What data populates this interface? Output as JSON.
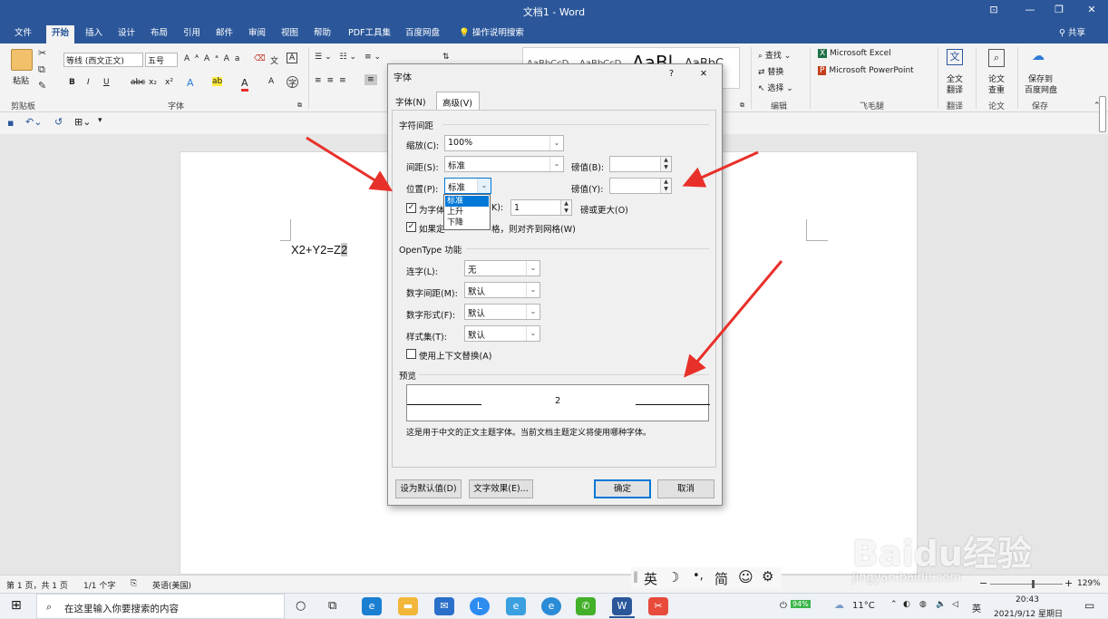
{
  "window": {
    "title": "文档1  -  Word",
    "min": "—",
    "restore": "❐",
    "close": "✕",
    "ribbon_opts": "⊡"
  },
  "tabs": [
    "文件",
    "开始",
    "插入",
    "设计",
    "布局",
    "引用",
    "邮件",
    "审阅",
    "视图",
    "帮助",
    "PDF工具集",
    "百度网盘",
    "操作说明搜索"
  ],
  "share": "共享",
  "ribbon": {
    "paste": "粘贴",
    "clipboard": "剪贴板",
    "font_name": "等线 (西文正文)",
    "font_size": "五号",
    "font_group": "字体",
    "find": "查找",
    "replace": "替换",
    "select": "选择",
    "edit_group": "编辑",
    "excel": "Microsoft Excel",
    "ppt": "Microsoft PowerPoint",
    "feimao": "飞毛腿",
    "fulltext_l1": "全文",
    "fulltext_l2": "翻译",
    "translate_group": "翻译",
    "paper_l1": "论文",
    "paper_l2": "查重",
    "paper_group": "论文",
    "save_l1": "保存到",
    "save_l2": "百度网盘",
    "save_group": "保存",
    "styles": [
      "AaBbCcD",
      "AaBbCcD",
      "AaBl",
      "AaBbC"
    ]
  },
  "document": {
    "text": "X2+Y2=Z",
    "selected": "2"
  },
  "dialog": {
    "title": "字体",
    "help": "?",
    "close": "✕",
    "tab_font": "字体(N)",
    "tab_advanced": "高级(V)",
    "section_spacing": "字符间距",
    "scale_label": "缩放(C):",
    "scale_value": "100%",
    "spacing_label": "间距(S):",
    "spacing_value": "标准",
    "position_label": "位置(P):",
    "position_value": "标准",
    "by1_label": "磅值(B):",
    "by2_label": "磅值(Y):",
    "dropdown": [
      "标准",
      "上升",
      "下降"
    ],
    "kerning_label": "为字体",
    "kerning_k": "K):",
    "kerning_value": "1",
    "kerning_suffix": "磅或更大(O)",
    "grid_label_a": "如果定",
    "grid_label_b": "格，则对齐到网格(W)",
    "section_opentype": "OpenType 功能",
    "ligature_label": "连字(L):",
    "ligature_value": "无",
    "numspacing_label": "数字间距(M):",
    "numspacing_value": "默认",
    "numform_label": "数字形式(F):",
    "numform_value": "默认",
    "styleset_label": "样式集(T):",
    "styleset_value": "默认",
    "contextual_label": "使用上下文替换(A)",
    "section_preview": "预览",
    "preview_text": "2",
    "preview_note": "这是用于中文的正文主题字体。当前文档主题定义将使用哪种字体。",
    "btn_default": "设为默认值(D)",
    "btn_effects": "文字效果(E)...",
    "btn_ok": "确定",
    "btn_cancel": "取消"
  },
  "status": {
    "page": "第 1 页，共 1 页",
    "words": "1/1 个字",
    "lang": "英语(美国)",
    "zoom": "129%"
  },
  "ime": {
    "lang": "英",
    "moon": "☽",
    "punct": "•,",
    "simp": "简",
    "emoji": "☺",
    "gear": "⚙"
  },
  "taskbar": {
    "search": "在这里输入你要搜索的内容",
    "battery": "94%",
    "temp": "11°C",
    "ime_lang": "英",
    "time": "20:43",
    "date": "2021/9/12 星期日"
  },
  "watermark": {
    "brand": "Baidu经验",
    "url": "jingyan.baidu.com"
  },
  "colors": {
    "accent": "#2b579a",
    "arrow": "#e8302a",
    "select": "#0078d7"
  }
}
